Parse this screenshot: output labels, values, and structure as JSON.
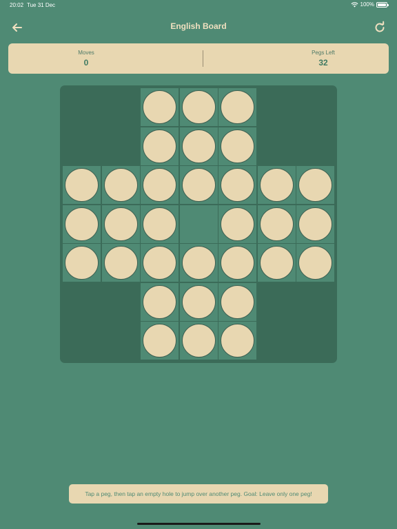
{
  "status_bar": {
    "time": "20:02",
    "date": "Tue 31 Dec",
    "battery": "100%"
  },
  "nav": {
    "title": "English Board",
    "back_icon": "arrow-left-icon",
    "refresh_icon": "refresh-icon"
  },
  "stats": {
    "moves_label": "Moves",
    "moves_value": "0",
    "pegs_label": "Pegs Left",
    "pegs_value": "32"
  },
  "board": {
    "layout": [
      "..XXX..",
      "..XXX..",
      "XXXXXXX",
      "XXX.XXX",
      "XXXXXXX",
      "..XXX..",
      "..XXX.."
    ],
    "holes": [
      [
        0,
        2,
        1
      ],
      [
        0,
        3,
        1
      ],
      [
        0,
        4,
        1
      ],
      [
        1,
        2,
        1
      ],
      [
        1,
        3,
        1
      ],
      [
        1,
        4,
        1
      ],
      [
        2,
        0,
        1
      ],
      [
        2,
        1,
        1
      ],
      [
        2,
        2,
        1
      ],
      [
        2,
        3,
        1
      ],
      [
        2,
        4,
        1
      ],
      [
        2,
        5,
        1
      ],
      [
        2,
        6,
        1
      ],
      [
        3,
        0,
        1
      ],
      [
        3,
        1,
        1
      ],
      [
        3,
        2,
        1
      ],
      [
        3,
        3,
        0
      ],
      [
        3,
        4,
        1
      ],
      [
        3,
        5,
        1
      ],
      [
        3,
        6,
        1
      ],
      [
        4,
        0,
        1
      ],
      [
        4,
        1,
        1
      ],
      [
        4,
        2,
        1
      ],
      [
        4,
        3,
        1
      ],
      [
        4,
        4,
        1
      ],
      [
        4,
        5,
        1
      ],
      [
        4,
        6,
        1
      ],
      [
        5,
        2,
        1
      ],
      [
        5,
        3,
        1
      ],
      [
        5,
        4,
        1
      ],
      [
        6,
        2,
        1
      ],
      [
        6,
        3,
        1
      ],
      [
        6,
        4,
        1
      ]
    ]
  },
  "hint": "Tap a peg, then tap an empty hole to jump over another peg. Goal: Leave only one peg!",
  "colors": {
    "background": "#4f8a74",
    "board": "#3b6b58",
    "peg": "#e8d7b1",
    "title": "#f0e0c0"
  }
}
